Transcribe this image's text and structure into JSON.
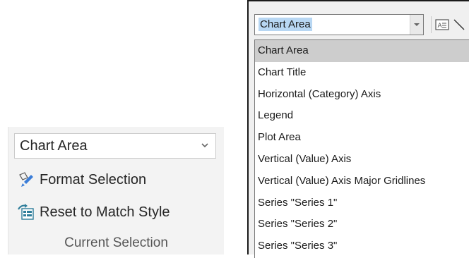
{
  "ribbon": {
    "selection_value": "Chart Area",
    "format_selection_label": "Format Selection",
    "reset_label": "Reset to Match Style",
    "group_label": "Current Selection"
  },
  "dropdown": {
    "value": "Chart Area",
    "items": [
      {
        "label": "Chart Area",
        "selected": true
      },
      {
        "label": "Chart Title"
      },
      {
        "label": "Horizontal (Category) Axis"
      },
      {
        "label": "Legend"
      },
      {
        "label": "Plot Area"
      },
      {
        "label": "Vertical (Value) Axis"
      },
      {
        "label": "Vertical (Value) Axis Major Gridlines"
      },
      {
        "label": "Series \"Series 1\""
      },
      {
        "label": "Series \"Series 2\""
      },
      {
        "label": "Series \"Series 3\""
      }
    ]
  },
  "icons": {
    "format_selection": "format-selection-icon",
    "reset_style": "reset-style-icon",
    "dropdown_arrow": "chevron-down-icon",
    "text_box": "text-box-icon",
    "line_shape": "line-shape-icon"
  },
  "colors": {
    "selection_highlight": "#b8d7f3",
    "selected_item": "#cdcdcd",
    "ribbon_bg": "#f3f3f3",
    "reset_icon_teal": "#2e7d9a",
    "format_brush_blue": "#3b7dd8"
  }
}
